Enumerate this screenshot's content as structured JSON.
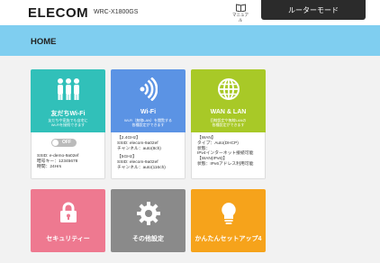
{
  "brand": {
    "logo": "ELECOM",
    "model": "WRC-X1800GS"
  },
  "manual": {
    "label": "マニュアル",
    "icon": "book-icon"
  },
  "mode_button": {
    "label": "ルーターモード"
  },
  "header": {
    "title": "HOME"
  },
  "cards": {
    "friends_wifi": {
      "name": "友だちWi-Fi",
      "desc_1": "友だちや家族でも自宅に",
      "desc_2": "Wi-Fiを接続できます",
      "toggle": "OFF",
      "ssid": "SSID: e-demo-9a02ef",
      "key": "暗号キー：12345678",
      "time": "時間：24Hrs"
    },
    "wifi": {
      "name": "Wi-Fi",
      "desc_1": "Wi-Fi（無線LAN）を閲覧する",
      "desc_2": "各種設定ができます",
      "band1": "【2.4GHz】",
      "band1_ssid": "SSID: elecom-9a02ef",
      "band1_ch": "チャンネル：auto(8ch)",
      "band2": "【5GHz】",
      "band2_ssid": "SSID: elecom-9a02ef",
      "band2_ch": "チャンネル：auto(116ch)"
    },
    "wan": {
      "name": "WAN & LAN",
      "desc_1": "回線設定や無線LANの",
      "desc_2": "各種設定ができます",
      "sec1": "【WAN】",
      "type": "タイプ：Auto(DHCP)",
      "state_label": "状態：",
      "state1": "IPv4インターネット接続可能",
      "sec2": "【WAN(IPv6)】",
      "state2": "状態：IPv6アドレス利用可能"
    }
  },
  "tiles": {
    "security": {
      "name": "セキュリティー"
    },
    "other": {
      "name": "その他設定"
    },
    "setup": {
      "name": "かんたんセットアップ4"
    }
  },
  "colors": {
    "friends": "#31c0b9",
    "wifi": "#5b93e4",
    "wan": "#a8c927",
    "security": "#ee7990",
    "other": "#8a8a8a",
    "setup": "#f6a31b",
    "header": "#7fcef0"
  }
}
